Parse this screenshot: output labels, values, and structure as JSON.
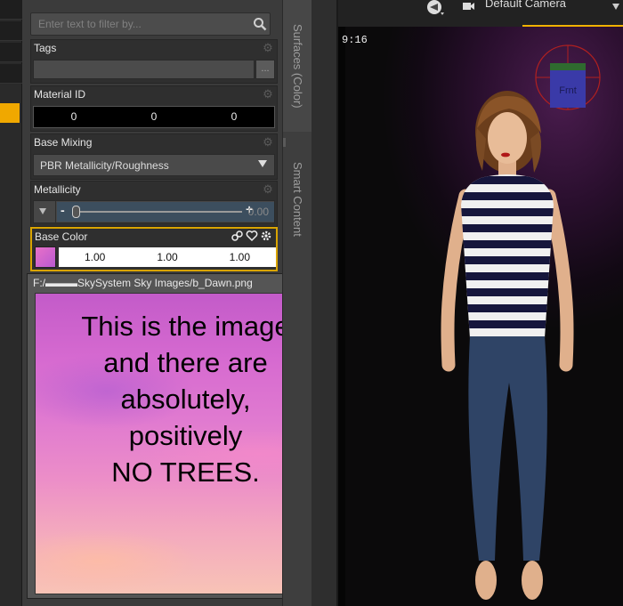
{
  "filter": {
    "placeholder": "Enter text to filter by..."
  },
  "properties": {
    "tags": {
      "label": "Tags",
      "button": "..."
    },
    "material_id": {
      "label": "Material ID",
      "values": [
        "0",
        "0",
        "0"
      ]
    },
    "base_mixing": {
      "label": "Base Mixing",
      "value": "PBR Metallicity/Roughness"
    },
    "metallicity": {
      "label": "Metallicity",
      "minus": "-",
      "plus": "+",
      "value": "0.00",
      "level": 0.0
    },
    "base_color": {
      "label": "Base Color",
      "values": [
        "1.00",
        "1.00",
        "1.00"
      ],
      "swatch_color": "#d86ccb"
    }
  },
  "image_tooltip": {
    "path": "F:/▬▬▬SkySystem Sky Images/b_Dawn.png",
    "note_lines": [
      "This is the image",
      "and there are",
      "absolutely,",
      "positively",
      "NO TREES."
    ]
  },
  "tabs": [
    {
      "label": "Surfaces (Color)",
      "active": true
    },
    {
      "label": "Smart Content",
      "active": false
    }
  ],
  "viewport": {
    "camera_label": "Default Camera",
    "aspect": "9:16",
    "cube_face": "Frnt"
  },
  "colors": {
    "accent": "#f0b200",
    "panel": "#3b3b3b"
  }
}
